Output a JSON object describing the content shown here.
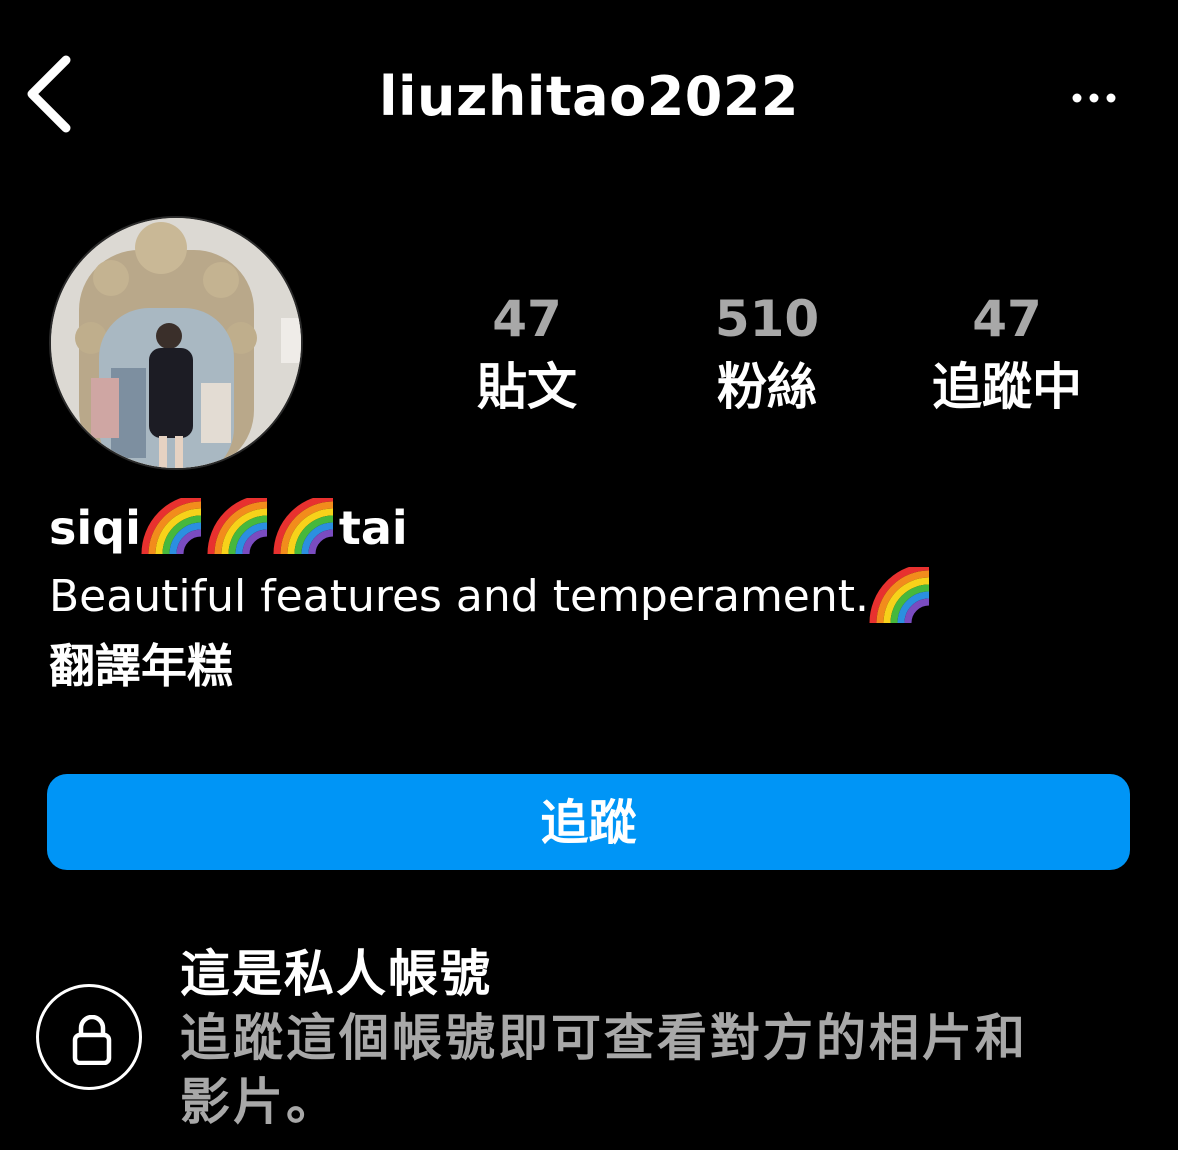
{
  "header": {
    "username": "liuzhitao2022",
    "back_icon": "chevron-left-icon",
    "more_icon": "more-horizontal-icon"
  },
  "stats": {
    "posts_value": "47",
    "posts_label": "貼文",
    "followers_value": "510",
    "followers_label": "粉絲",
    "following_value": "47",
    "following_label": "追蹤中"
  },
  "profile": {
    "name_prefix": "siqi",
    "name_suffix": "tai",
    "name_emoji": "rainbow-icon",
    "bio_line1": "Beautiful features and temperament.",
    "bio_line2": "翻譯年糕"
  },
  "actions": {
    "follow_label": "追蹤"
  },
  "private_notice": {
    "icon": "lock-icon",
    "title": "這是私人帳號",
    "description": "追蹤這個帳號即可查看對方的相片和影片。"
  },
  "colors": {
    "background": "#000000",
    "accent": "#0095f6",
    "secondary_text": "#a8a8a8"
  }
}
